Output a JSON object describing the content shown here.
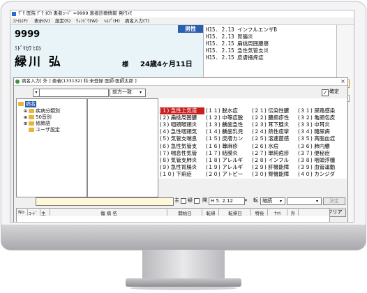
{
  "app": {
    "title_text": "ﾃﾞﾓ 医院 ﾃﾞﾓ ﾀﾛｳ 患者ｺｰﾄﾞ =9999 患者診療情報 発行ﾒﾓ",
    "menu": [
      "ﾌｧｲﾙ(F)",
      "表示(V)",
      "設定(S)",
      "ｳｨﾝﾄﾞｳ(W)",
      "ﾍﾙﾌﾟ(H)",
      "病名入力(T)"
    ]
  },
  "patient": {
    "id": "9999",
    "kana": "ﾐﾄﾞﾘｶﾜ ﾋﾛｼ",
    "name": "緑川 弘",
    "honorific": "様",
    "age": "24歳4ヶ月11日",
    "sex": "男性"
  },
  "history": [
    "H15. 2.13 インフルエンザB",
    "H15. 2.13 胃腸炎",
    "H15. 2.15 扁桃周囲膿瘍",
    "H15. 2.15 急性気管支炎",
    "H15. 2.15 皮膚掻痒症"
  ],
  "dialog": {
    "title": "病名入力[ 外 ] 患者(133132) 科:未登録 医師:医師太郎 ]",
    "close_glyph": "×",
    "search_value": "",
    "match_mode": "前方一致",
    "confirm_label": "確定",
    "confirm_checked": true,
    "tree": [
      {
        "label": "病名",
        "level": 0,
        "selected": true
      },
      {
        "label": "疾病分類別",
        "level": 1
      },
      {
        "label": "50音別",
        "level": 1
      },
      {
        "label": "修飾語",
        "level": 1
      },
      {
        "label": "ユーザ設定",
        "level": 1
      }
    ],
    "disease_grid": [
      [
        "(１) 急性上気道",
        "(１１) 脱水症",
        "(２１) 伝染性膿",
        "(３１) 尿路感染"
      ],
      [
        "(２) 扁桃周囲膿",
        "(１２) 中等症脱",
        "(２２) 膿痂疹性",
        "(３２) 亀頭包皮"
      ],
      [
        "(３) 咽頭喉頭炎",
        "(１３) 齲歯急性",
        "(２３) 耳下腺炎",
        "(３３) 中耳炎"
      ],
      [
        "(４) 急性咽頭気",
        "(１４) 齲歯乳児",
        "(２４) 熱性痙攣",
        "(３４) 糖尿病"
      ],
      [
        "(５) 気管支喘息",
        "(１５) 皮膚カン",
        "(２５) 溶連菌感",
        "(３５) 高脂血症"
      ],
      [
        "(６) 急性気管支",
        "(１６) 蕁麻疹",
        "(２６) 水痘",
        "(３６) 肺内膿"
      ],
      [
        "(７) 喘息性気管",
        "(１７) 結膜炎",
        "(２７) 単純疱疹",
        "(３７) 便秘症"
      ],
      [
        "(８) 気管支肺炎",
        "(１８) アレルギ",
        "(２８) インフル",
        "(３８) 咽頭浮腫"
      ],
      [
        "(９) 急性胃腸炎",
        "(１９) アレルギ",
        "(２９) 肝機能障",
        "(３９) 血管運動"
      ],
      [
        "(１０) 下痢症",
        "(２０) アトピー",
        "(３０) 腎機能障",
        "(４０) カンジダ"
      ]
    ],
    "entry": {
      "main_label": "主",
      "doubt_label": "疑",
      "start_label": "開",
      "start_date": "H 5. 2.12",
      "outcome_label": "転",
      "outcome_value": "継続",
      "register_label": "決定",
      "clear_label": "クリア"
    },
    "table_columns": [
      "No",
      "ｺｰﾄﾞ",
      "主",
      "傷 病 名",
      "開始日",
      "転帰",
      "転帰日",
      "特長",
      "ｻﾏﾘ",
      "外"
    ]
  }
}
